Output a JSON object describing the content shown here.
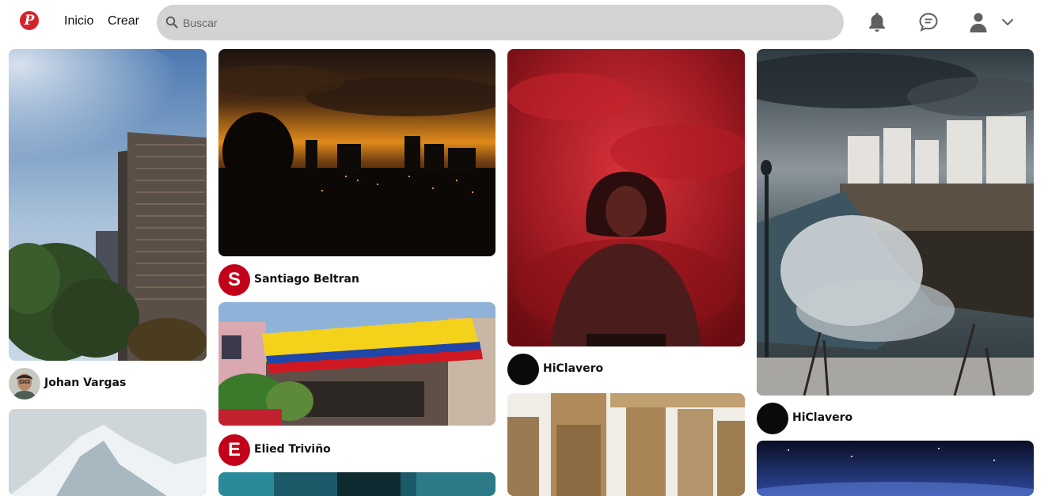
{
  "header": {
    "logo_icon": "pinterest-logo-icon",
    "logo_letter": "P",
    "nav": [
      {
        "label": "Inicio"
      },
      {
        "label": "Crear"
      }
    ],
    "search": {
      "placeholder": "Buscar",
      "value": ""
    },
    "icons": [
      "bell-icon",
      "chat-icon",
      "user-icon",
      "chevron-down-icon"
    ]
  },
  "colors": {
    "brand": "#d5232b",
    "search_bg": "#d3d3d3",
    "avatar_letter_bg": "#c3001a"
  },
  "pins": [
    {
      "author": "Johan Vargas",
      "image": "city-skyscraper-photo"
    },
    {
      "author": "",
      "image": "snowy-mountain-photo"
    },
    {
      "author": "Santiago Beltran",
      "image": "city-sunset-night-photo"
    },
    {
      "author": "Elied Triviño",
      "image": "university-banner-photo"
    },
    {
      "author": "",
      "image": "ocean-waves-photo"
    },
    {
      "author": "HiClavero",
      "image": "red-sky-woman-photo"
    },
    {
      "author": "",
      "image": "egyptian-columns-photo"
    },
    {
      "author": "HiClavero",
      "image": "coastal-waves-town-photo"
    },
    {
      "author": "",
      "image": "night-sky-photo"
    }
  ],
  "avatars": {
    "santiago": "S",
    "elied": "E"
  }
}
